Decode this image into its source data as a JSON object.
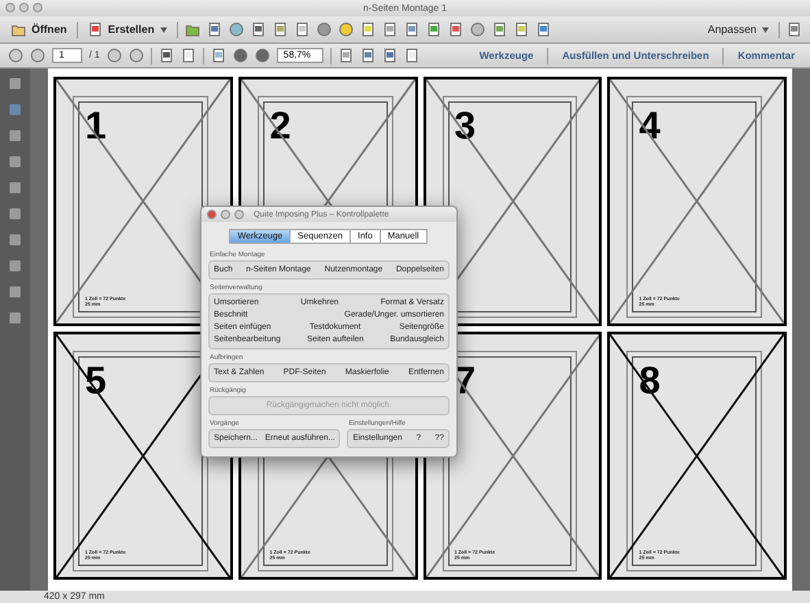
{
  "window": {
    "title": "n-Seiten Montage 1"
  },
  "toolbar": {
    "open": "Öffnen",
    "create": "Erstellen",
    "customize": "Anpassen"
  },
  "navigation": {
    "page": "1",
    "page_count": "/ 1",
    "zoom": "58,7%"
  },
  "panels": [
    "Werkzeuge",
    "Ausfüllen und Unterschreiben",
    "Kommentar"
  ],
  "pages": [
    {
      "number": "1",
      "note": "1 Zoll = 72 Punkte",
      "scale": "25 mm"
    },
    {
      "number": "2"
    },
    {
      "number": "3"
    },
    {
      "number": "4",
      "note": "1 Zoll = 72 Punkte",
      "scale": "25 mm"
    },
    {
      "number": "5",
      "note": "1 Zoll = 72 Punkte",
      "scale": "25 mm"
    },
    {
      "note": "1 Zoll = 72 Punkte",
      "scale": "25 mm"
    },
    {
      "number": "7",
      "note": "1 Zoll = 72 Punkte",
      "scale": "25 mm"
    },
    {
      "number": "8",
      "note": "1 Zoll = 72 Punkte",
      "scale": "25 mm"
    }
  ],
  "palette": {
    "title": "Quite Imposing Plus – Kontrollpalette",
    "tabs": [
      {
        "label": "Werkzeuge",
        "selected": true
      },
      {
        "label": "Sequenzen",
        "selected": false
      },
      {
        "label": "Info",
        "selected": false
      },
      {
        "label": "Manuell",
        "selected": false
      }
    ],
    "sections": [
      {
        "label": "Einfache Montage",
        "disabled": false,
        "rows": [
          [
            "Buch",
            "n-Seiten Montage",
            "Nutzenmontage",
            "Doppelseiten"
          ]
        ]
      },
      {
        "label": "Seitenverwaltung",
        "disabled": false,
        "rows": [
          [
            "Umsortieren",
            "Umkehren",
            "Format & Versatz"
          ],
          [
            "Beschnitt",
            "Gerade/Unger. umsortieren"
          ],
          [
            "Seiten einfügen",
            "Testdokument",
            "Seitengröße"
          ],
          [
            "Seitenbearbeitung",
            "Seiten aufteilen",
            "Bundausgleich"
          ]
        ]
      },
      {
        "label": "Aufbringen",
        "disabled": false,
        "rows": [
          [
            "Text & Zahlen",
            "PDF-Seiten",
            "Maskierfolie",
            "Entfernen"
          ]
        ]
      },
      {
        "label": "Rückgängig",
        "disabled": true,
        "rows": [
          [
            "Rückgängigmachen nicht möglich."
          ]
        ]
      }
    ],
    "bottom_sections": [
      {
        "label": "Vorgänge",
        "buttons": [
          "Speichern...",
          "Erneut ausführen..."
        ]
      },
      {
        "label": "Einstellungen/Hilfe",
        "buttons": [
          "Einstellungen",
          "?",
          "??"
        ]
      }
    ]
  },
  "status_bar": "420 x 297 mm"
}
